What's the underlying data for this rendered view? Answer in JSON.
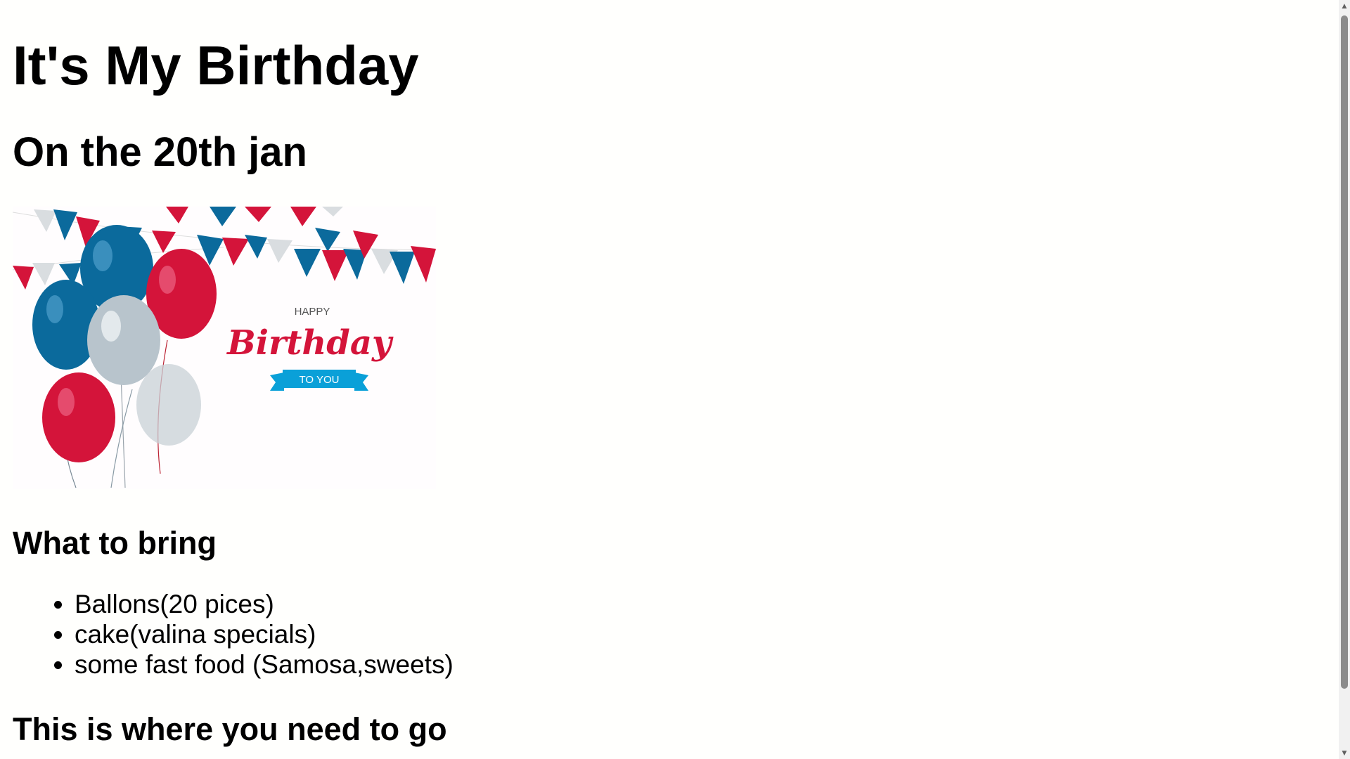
{
  "page": {
    "title": "It's My Birthday",
    "subtitle": "On the 20th jan"
  },
  "banner_image": {
    "happy_text": "HAPPY",
    "birthday_text": "Birthday",
    "to_you_text": "TO YOU",
    "colors": {
      "red": "#d4143a",
      "blue": "#0b6a9c",
      "silver": "#b8c4cc",
      "ribbon": "#0aa0d8"
    }
  },
  "bring_section": {
    "heading": "What to bring",
    "items": [
      "Ballons(20 pices)",
      "cake(valina specials)",
      "some fast food (Samosa,sweets)"
    ]
  },
  "where_section": {
    "heading": "This is where you need to go"
  },
  "scrollbar": {
    "up_icon": "triangle-up-icon",
    "down_icon": "triangle-down-icon"
  }
}
